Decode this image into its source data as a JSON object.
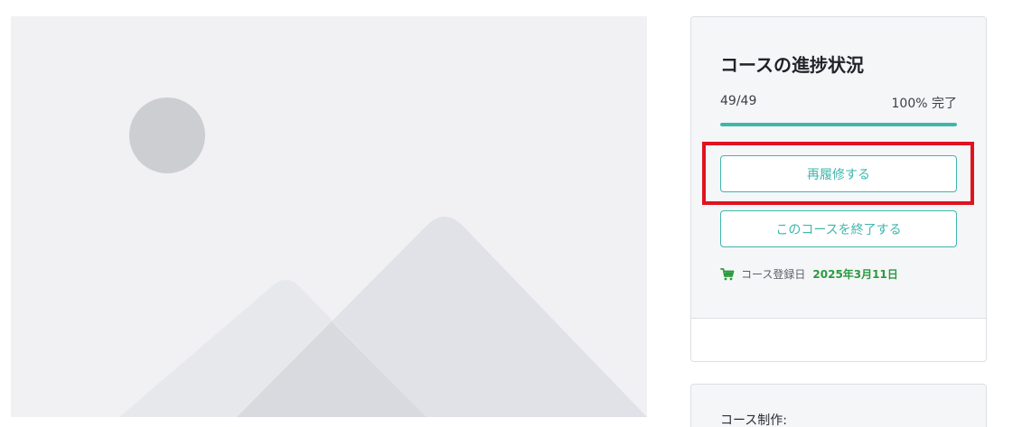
{
  "thumbnail": {
    "icon": "image-placeholder-icon"
  },
  "progress_card": {
    "title": "コースの進捗状況",
    "count": "49/49",
    "percent_label": "100% 完了",
    "progress_fraction": 1.0,
    "accent_color": "#3fb6ac",
    "retake_button": "再履修する",
    "finish_button": "このコースを終了する",
    "enroll_label": "コース登録日",
    "enroll_date": "2025年3月11日",
    "enroll_icon": "cart-icon",
    "date_color": "#2b9a3d"
  },
  "author_card": {
    "label": "コース制作:"
  },
  "highlight_color": "#e0131f"
}
